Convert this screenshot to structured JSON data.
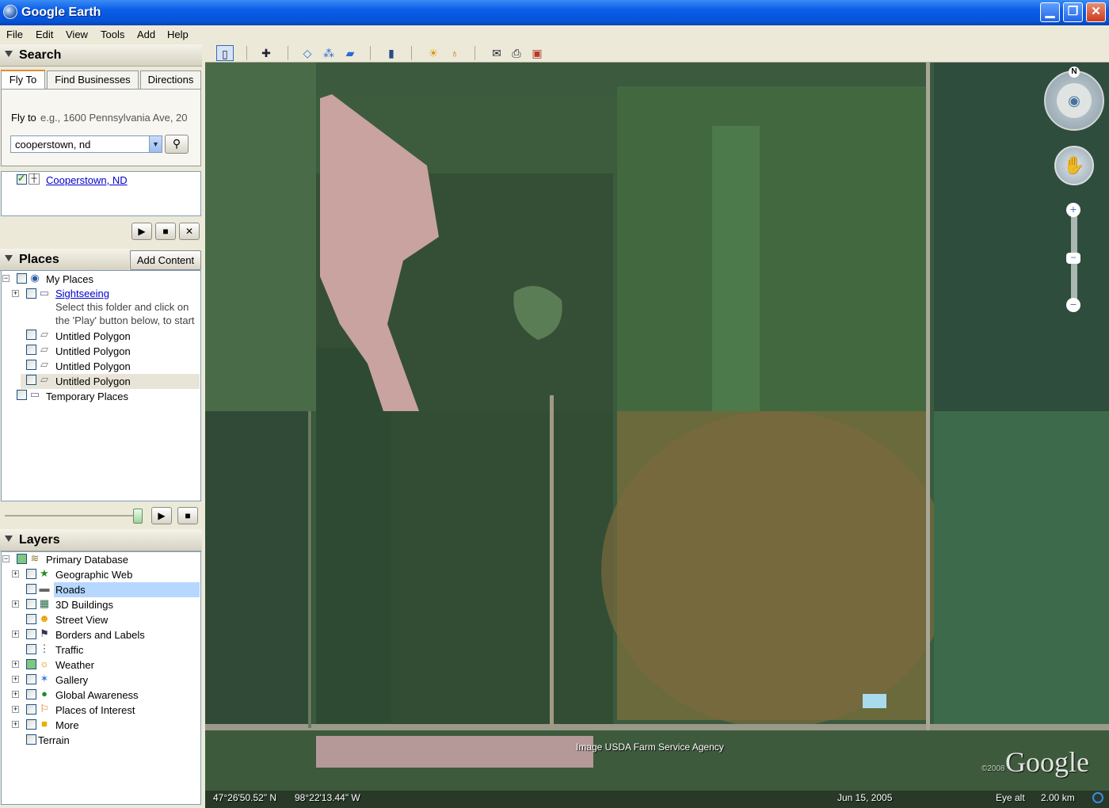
{
  "window": {
    "title": "Google Earth"
  },
  "menu": [
    "File",
    "Edit",
    "View",
    "Tools",
    "Add",
    "Help"
  ],
  "search": {
    "header": "Search",
    "tabs": [
      "Fly To",
      "Find Businesses",
      "Directions"
    ],
    "fly_to_label": "Fly to",
    "fly_to_hint": "e.g., 1600 Pennsylvania Ave, 20",
    "input_value": "cooperstown, nd",
    "result": "Cooperstown, ND"
  },
  "places": {
    "header": "Places",
    "add_content": "Add Content",
    "items": [
      {
        "label": "My Places"
      },
      {
        "label": "Sightseeing"
      },
      {
        "label": "Select this folder and click on"
      },
      {
        "label": "the 'Play' button below, to start"
      },
      {
        "label": "Untitled Polygon"
      },
      {
        "label": "Untitled Polygon"
      },
      {
        "label": "Untitled Polygon"
      },
      {
        "label": "Untitled Polygon"
      },
      {
        "label": "Temporary Places"
      }
    ]
  },
  "layers": {
    "header": "Layers",
    "items": [
      {
        "label": "Primary Database"
      },
      {
        "label": "Geographic Web"
      },
      {
        "label": "Roads"
      },
      {
        "label": "3D Buildings"
      },
      {
        "label": "Street View"
      },
      {
        "label": "Borders and Labels"
      },
      {
        "label": "Traffic"
      },
      {
        "label": "Weather"
      },
      {
        "label": "Gallery"
      },
      {
        "label": "Global Awareness"
      },
      {
        "label": "Places of Interest"
      },
      {
        "label": "More"
      },
      {
        "label": "Terrain"
      }
    ]
  },
  "map": {
    "compass_n": "N",
    "attribution": "Image USDA Farm Service Agency",
    "logo": "Google",
    "copyright": "©2008",
    "lat": "47°26'50.52\" N",
    "lon": "98°22'13.44\" W",
    "date": "Jun 15, 2005",
    "eye_alt_label": "Eye alt",
    "eye_alt_value": "2.00 km"
  },
  "colors": {
    "titlebar": "#0a5ce8",
    "selected": "#b6d7ff",
    "link": "#0000cc"
  },
  "icons": [
    "globe-icon",
    "folder-icon",
    "polygon-icon",
    "star-icon",
    "building-icon",
    "person-icon",
    "flag-icon",
    "traffic-icon",
    "sun-icon",
    "gallery-icon",
    "earth-icon",
    "pin-icon",
    "search-icon"
  ]
}
